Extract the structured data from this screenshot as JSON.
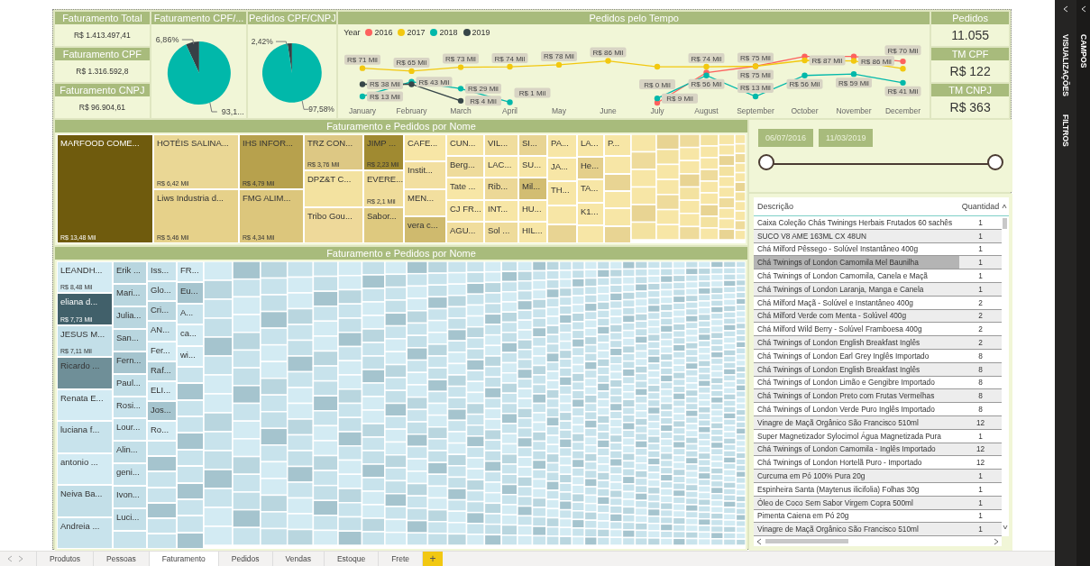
{
  "kpi_cards": [
    {
      "title": "Faturamento Total",
      "value": "R$ 1.413.497,41"
    },
    {
      "title": "Faturamento CPF",
      "value": "R$ 1.316.592,8"
    },
    {
      "title": "Faturamento CNPJ",
      "value": "R$ 96.904,61"
    }
  ],
  "pie_charts": [
    {
      "title": "Faturamento CPF/...",
      "chart_data": {
        "type": "pie",
        "values": [
          6.86,
          93.14
        ],
        "colors": [
          "#374046",
          "#01b8aa"
        ],
        "value_labels": [
          "6,86%",
          "93,1..."
        ]
      }
    },
    {
      "title": "Pedidos CPF/CNPJ",
      "chart_data": {
        "type": "pie",
        "values": [
          2.42,
          97.58
        ],
        "colors": [
          "#374046",
          "#01b8aa"
        ],
        "value_labels": [
          "2,42%",
          "97,58%"
        ]
      }
    }
  ],
  "line_chart": {
    "title": "Pedidos pelo Tempo",
    "legend_title": "Year",
    "chart_data": {
      "type": "line",
      "data_labels": true,
      "categories": [
        "January",
        "February",
        "March",
        "April",
        "May",
        "June",
        "July",
        "August",
        "September",
        "October",
        "November",
        "December"
      ],
      "series": [
        {
          "name": "2016",
          "color": "#fd625e",
          "marker": true,
          "values": [
            null,
            null,
            null,
            null,
            null,
            null,
            0,
            62,
            75,
            95,
            95,
            85
          ],
          "value_labels": [
            null,
            null,
            null,
            null,
            null,
            null,
            "R$ 0 Mil",
            null,
            "R$ 75 Mil",
            null,
            null,
            null
          ]
        },
        {
          "name": "2017",
          "color": "#f2c80f",
          "marker": true,
          "values": [
            71,
            65,
            73,
            74,
            78,
            86,
            74,
            74,
            75,
            87,
            86,
            70
          ],
          "value_labels": [
            "R$ 71 Mil",
            "R$ 65 Mil",
            "R$ 73 Mil",
            "R$ 74 Mil",
            "R$ 78 Mil",
            "R$ 86 Mil",
            null,
            "R$ 74 Mil",
            "R$ 75 Mil",
            "R$ 87 Mil",
            "R$ 86 Mil",
            "R$ 70 Mil"
          ]
        },
        {
          "name": "2018",
          "color": "#01b8aa",
          "marker": true,
          "values": [
            13,
            43,
            29,
            1,
            null,
            null,
            9,
            56,
            13,
            56,
            59,
            41
          ],
          "value_labels": [
            "R$ 13 Mil",
            "R$ 43 Mil",
            "R$ 29 Mil",
            "R$ 1 Mil",
            null,
            null,
            "R$ 9 Mil",
            "R$ 56 Mil",
            "R$ 13 Mil",
            "R$ 56 Mil",
            "R$ 59 Mil",
            "R$ 41 Mil"
          ]
        },
        {
          "name": "2019",
          "color": "#374649",
          "marker": true,
          "values": [
            38,
            38,
            4,
            null,
            null,
            null,
            null,
            null,
            null,
            null,
            null,
            null
          ],
          "value_labels": [
            "R$ 38 Mil",
            null,
            "R$ 4 Mil",
            null,
            null,
            null,
            null,
            null,
            null,
            null,
            null,
            null
          ]
        }
      ]
    }
  },
  "summary_cards": [
    {
      "title": "Pedidos",
      "value": "11.055"
    },
    {
      "title": "TM CPF",
      "value": "R$ 122"
    },
    {
      "title": "TM CNPJ",
      "value": "R$ 363"
    }
  ],
  "treemaps": [
    {
      "title": "Faturamento e Pedidos por Nome",
      "columns": [
        {
          "cells": [
            {
              "label": "MARFOOD COME...",
              "value_label": "R$ 13,48 Mil",
              "color": "#6f5b0d"
            }
          ]
        },
        {
          "cells": [
            {
              "label": "HOTÉIS SALINA...",
              "value_label": "R$ 6,42 Mil",
              "color": "#ead795"
            },
            {
              "label": "Liws Industria d...",
              "value_label": "R$ 5,46 Mil",
              "color": "#e6d18a"
            }
          ]
        },
        {
          "cells": [
            {
              "label": "IHS INFOR...",
              "value_label": "R$ 4,79 Mil",
              "color": "#b7a14d"
            },
            {
              "label": "FMG ALIM...",
              "value_label": "R$ 4,34 Mil",
              "color": "#dcc67c"
            }
          ]
        },
        {
          "cells": [
            {
              "label": "TRZ CON...",
              "value_label": "R$ 3,76 Mil",
              "color": "#ddc884"
            },
            {
              "label": "DPZ&T C...",
              "color": "#f3e2a0"
            },
            {
              "label": "Tribo Gou...",
              "color": "#eed99a"
            }
          ]
        },
        {
          "cells": [
            {
              "label": "JIMP ...",
              "value_label": "R$ 2,23 Mil",
              "color": "#a08a31"
            },
            {
              "label": "EVERE...",
              "value_label": "R$ 2,1 Mil",
              "color": "#efdc9a"
            },
            {
              "label": "Sabor...",
              "color": "#dec97f"
            }
          ]
        },
        {
          "cells": [
            {
              "label": "CAFE...",
              "color": "#f7e6a6"
            },
            {
              "label": "Instit...",
              "color": "#f2dfa0"
            },
            {
              "label": "MEN...",
              "color": "#f2df9f"
            },
            {
              "label": "vera c...",
              "color": "#cfba6e"
            }
          ]
        },
        {
          "cells": [
            {
              "label": "CUN...",
              "color": "#f7e6a6"
            },
            {
              "label": "Berg...",
              "color": "#eedb9b"
            },
            {
              "label": "Tate ...",
              "color": "#f7e6a6"
            },
            {
              "label": "CJ FR...",
              "color": "#f7e6a6"
            },
            {
              "label": "AGU...",
              "color": "#f0dd9d"
            }
          ]
        },
        {
          "cells": [
            {
              "label": "VIL...",
              "color": "#f0dd9d"
            },
            {
              "label": "LAC...",
              "color": "#f7e6a6"
            },
            {
              "label": "Rib...",
              "color": "#ecd897"
            },
            {
              "label": "INT...",
              "color": "#f7e6a6"
            },
            {
              "label": "Sol ...",
              "color": "#eedb9b"
            }
          ]
        },
        {
          "cells": [
            {
              "label": "SI...",
              "color": "#e8d493"
            },
            {
              "label": "SU...",
              "color": "#f7e6a6"
            },
            {
              "label": "Mil...",
              "color": "#d2bd72"
            },
            {
              "label": "HU...",
              "color": "#f7e6a6"
            },
            {
              "label": "HIL...",
              "color": "#f7e6a6"
            }
          ]
        },
        {
          "cells": [
            {
              "label": "PA...",
              "color": "#f7e6a6"
            },
            {
              "label": "JA...",
              "color": "#f7e6a6"
            },
            {
              "label": "TH...",
              "color": "#f7e6a6"
            }
          ]
        },
        {
          "cells": [
            {
              "label": "LA...",
              "color": "#f7e6a6"
            },
            {
              "label": "He...",
              "color": "#e4cf8b"
            },
            {
              "label": "TA...",
              "color": "#f7e6a6"
            },
            {
              "label": "K1...",
              "color": "#f7e6a6"
            }
          ]
        },
        {
          "cells": [
            {
              "label": "P...",
              "color": "#f7e6a6"
            }
          ]
        }
      ]
    },
    {
      "title": "Faturamento e Pedidos por Nome",
      "columns": [
        {
          "cells": [
            {
              "label": "LEANDH...",
              "value_label": "R$ 8,48 Mil",
              "color": "#d3ebf3"
            },
            {
              "label": "eliana d...",
              "value_label": "R$ 7,73 Mil",
              "color": "#41606a"
            },
            {
              "label": "JESUS M...",
              "value_label": "R$ 7,11 Mil",
              "color": "#c3dfe8"
            },
            {
              "label": "Ricardo ...",
              "color": "#6f8f98"
            },
            {
              "label": "Renata E...",
              "color": "#d3ebf3"
            },
            {
              "label": "luciana f...",
              "color": "#c8e3ec"
            },
            {
              "label": "antonio ...",
              "color": "#d3ebf3"
            },
            {
              "label": "Neiva Ba...",
              "color": "#c3dfe8"
            },
            {
              "label": "Andreia ...",
              "color": "#c8e3ec"
            }
          ]
        },
        {
          "cells": [
            {
              "label": "Erik ...",
              "color": "#b9d6df"
            },
            {
              "label": "Mari...",
              "color": "#b9d6df"
            },
            {
              "label": "Julia...",
              "color": "#b9d6df"
            },
            {
              "label": "San...",
              "color": "#b9d6df"
            },
            {
              "label": "Fern...",
              "color": "#a5c4ce"
            },
            {
              "label": "Paul...",
              "color": "#c3dfe8"
            },
            {
              "label": "Rosi...",
              "color": "#c8e3ec"
            },
            {
              "label": "Lour...",
              "color": "#c8e3ec"
            },
            {
              "label": "Alin...",
              "color": "#c3dfe8"
            },
            {
              "label": "geni...",
              "color": "#c8e3ec"
            },
            {
              "label": "Ivon...",
              "color": "#c3dfe8"
            },
            {
              "label": "Luci...",
              "color": "#c3dfe8"
            }
          ]
        },
        {
          "cells": [
            {
              "label": "Iss...",
              "color": "#c8e3ec"
            },
            {
              "label": "Glo...",
              "color": "#c3dfe8"
            },
            {
              "label": "Cri...",
              "color": "#b9d6df"
            },
            {
              "label": "AN...",
              "color": "#c8e3ec"
            },
            {
              "label": "Fer...",
              "color": "#d3ebf3"
            },
            {
              "label": "Raf...",
              "color": "#b9d6df"
            },
            {
              "label": "ELI...",
              "color": "#d3ebf3"
            },
            {
              "label": "Jos...",
              "color": "#a5c4ce"
            },
            {
              "label": "Ro...",
              "color": "#d3ebf3"
            }
          ]
        },
        {
          "cells": [
            {
              "label": "FR...",
              "color": "#d3ebf3"
            },
            {
              "label": "Eu...",
              "color": "#a5c4ce"
            },
            {
              "label": "A...",
              "color": "#c8e3ec"
            },
            {
              "label": "ca...",
              "color": "#d3ebf3"
            },
            {
              "label": "wi...",
              "color": "#d3ebf3"
            }
          ]
        }
      ]
    }
  ],
  "date_slicer": {
    "start": "06/07/2016",
    "end": "11/03/2019"
  },
  "table": {
    "columns": [
      "Descrição",
      "Quantidad"
    ],
    "rows": [
      {
        "cells": [
          "Caixa Coleção Chás Twinings Herbais Frutados 60 sachês",
          "1"
        ],
        "selected": false
      },
      {
        "cells": [
          "SUCO V8 AME 163ML CX 48UN",
          "1"
        ],
        "selected": false
      },
      {
        "cells": [
          "Chá Milford Pêssego - Solúvel Instantâneo 400g",
          "1"
        ],
        "selected": false
      },
      {
        "cells": [
          "Chá Twinings of London Camomila Mel Baunilha",
          "1"
        ],
        "selected": true
      },
      {
        "cells": [
          "Chá Twinings of London Camomila, Canela e Maçã",
          "1"
        ],
        "selected": false
      },
      {
        "cells": [
          "Chá Twinings of London Laranja, Manga e Canela",
          "1"
        ],
        "selected": false
      },
      {
        "cells": [
          "Chá Milford Maçã - Solúvel e Instantâneo 400g",
          "2"
        ],
        "selected": false
      },
      {
        "cells": [
          "Chá Milford Verde com Menta - Solúvel 400g",
          "2"
        ],
        "selected": false
      },
      {
        "cells": [
          "Chá Milford Wild Berry - Solúvel Framboesa 400g",
          "2"
        ],
        "selected": false
      },
      {
        "cells": [
          "Chá Twinings of London English Breakfast Inglês",
          "2"
        ],
        "selected": false
      },
      {
        "cells": [
          "Chá Twinings of London Earl Grey Inglês Importado",
          "8"
        ],
        "selected": false
      },
      {
        "cells": [
          "Chá Twinings of London English Breakfast Inglês",
          "8"
        ],
        "selected": false
      },
      {
        "cells": [
          "Chá Twinings of London Limão e Gengibre Importado",
          "8"
        ],
        "selected": false
      },
      {
        "cells": [
          "Chá Twinings of London Preto com Frutas Vermelhas",
          "8"
        ],
        "selected": false
      },
      {
        "cells": [
          "Chá Twinings of London Verde Puro Inglês Importado",
          "8"
        ],
        "selected": false
      },
      {
        "cells": [
          "Vinagre de Maçã Orgânico São Francisco 510ml",
          "12"
        ],
        "selected": false
      },
      {
        "cells": [
          "Super Magnetizador Sylocimol Água Magnetizada Pura",
          "1"
        ],
        "selected": false
      },
      {
        "cells": [
          "Chá Twinings of London Camomila - Inglês Importado",
          "12"
        ],
        "selected": false
      },
      {
        "cells": [
          "Chá Twinings of London Hortelã Puro - Importado",
          "12"
        ],
        "selected": false
      },
      {
        "cells": [
          "Curcuma em Pó 100% Pura 20g",
          "1"
        ],
        "selected": false
      },
      {
        "cells": [
          "Espinheira Santa (Maytenus ilicifolia) Folhas 30g",
          "1"
        ],
        "selected": false
      },
      {
        "cells": [
          "Óleo de Coco Sem Sabor Virgem Copra 500ml",
          "1"
        ],
        "selected": false
      },
      {
        "cells": [
          "Pimenta Caiena em Pó 20g",
          "1"
        ],
        "selected": false
      },
      {
        "cells": [
          "Vinagre de Maçã Orgânico São Francisco 510ml",
          "1"
        ],
        "selected": false
      }
    ]
  },
  "page_tabs": [
    {
      "label": "Produtos",
      "selected": false
    },
    {
      "label": "Pessoas",
      "selected": false
    },
    {
      "label": "Faturamento",
      "selected": true
    },
    {
      "label": "Pedidos",
      "selected": false
    },
    {
      "label": "Vendas",
      "selected": false
    },
    {
      "label": "Estoque",
      "selected": false
    },
    {
      "label": "Frete",
      "selected": false
    }
  ],
  "add_page_button": "+",
  "side_panes": {
    "left": [
      "VISUALIZAÇÕES",
      "FILTROS"
    ],
    "right": [
      "CAMPOS"
    ]
  }
}
